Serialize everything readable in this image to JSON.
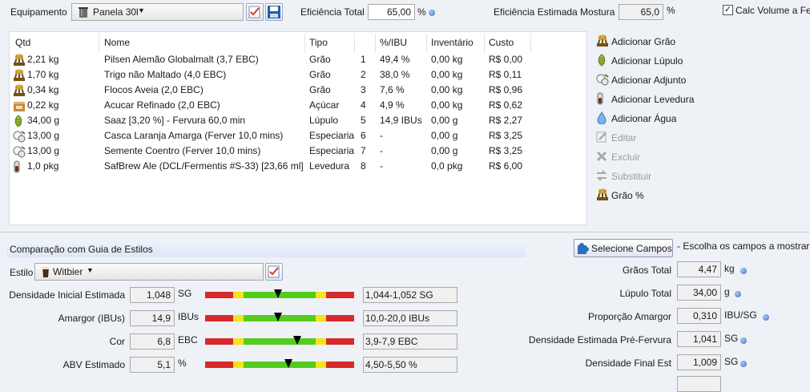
{
  "equipment": {
    "label": "Equipamento",
    "value": "Panela 30l",
    "total_efficiency_label": "Eficiência Total",
    "total_efficiency_value": "65,00",
    "total_efficiency_unit": "%",
    "mash_efficiency_label": "Eficiência Estimada Mostura",
    "mash_efficiency_value": "65,0",
    "mash_efficiency_unit": "%",
    "calc_volume_label": "Calc Volume a Fer",
    "calc_volume_checked": true
  },
  "ingredients": {
    "columns": [
      "Qtd",
      "Nome",
      "Tipo",
      "%/IBU",
      "Inventário",
      "Custo"
    ],
    "rows": [
      {
        "icon": "grain-icon",
        "qty": "2,21 kg",
        "name": "Pilsen Alemão Globalmalt (3,7 EBC)",
        "type": "Grão",
        "order": "1",
        "pct": "49,4 %",
        "inventory": "0,00 kg",
        "cost": "R$ 0,00"
      },
      {
        "icon": "grain-icon",
        "qty": "1,70 kg",
        "name": "Trigo não Maltado (4,0 EBC)",
        "type": "Grão",
        "order": "2",
        "pct": "38,0 %",
        "inventory": "0,00 kg",
        "cost": "R$ 0,11"
      },
      {
        "icon": "grain-icon",
        "qty": "0,34 kg",
        "name": "Flocos Aveia (2,0 EBC)",
        "type": "Grão",
        "order": "3",
        "pct": "7,6 %",
        "inventory": "0,00 kg",
        "cost": "R$ 0,96"
      },
      {
        "icon": "sugar-icon",
        "qty": "0,22 kg",
        "name": "Acucar Refinado (2,0 EBC)",
        "type": "Açúcar",
        "order": "4",
        "pct": "4,9 %",
        "inventory": "0,00 kg",
        "cost": "R$ 0,62"
      },
      {
        "icon": "hop-icon",
        "qty": "34,00 g",
        "name": "Saaz [3,20 %] - Fervura 60,0 min",
        "type": "Lúpulo",
        "order": "5",
        "pct": "14,9 IBUs",
        "inventory": "0,00 g",
        "cost": "R$ 2,27"
      },
      {
        "icon": "adjunct-icon",
        "qty": "13,00 g",
        "name": "Casca Laranja Amarga (Ferver 10,0 mins)",
        "type": "Especiaria",
        "order": "6",
        "pct": "-",
        "inventory": "0,00 g",
        "cost": "R$ 3,25"
      },
      {
        "icon": "adjunct-icon",
        "qty": "13,00 g",
        "name": "Semente Coentro (Ferver 10,0 mins)",
        "type": "Especiaria",
        "order": "7",
        "pct": "-",
        "inventory": "0,00 g",
        "cost": "R$ 3,25"
      },
      {
        "icon": "yeast-icon",
        "qty": "1,0 pkg",
        "name": "SafBrew Ale (DCL/Fermentis #S-33) [23,66 ml]",
        "type": "Levedura",
        "order": "8",
        "pct": "-",
        "inventory": "0,0 pkg",
        "cost": "R$ 6,00"
      }
    ]
  },
  "actions": [
    {
      "label": "Adicionar Grão",
      "icon": "grain-icon",
      "enabled": true
    },
    {
      "label": "Adicionar Lúpulo",
      "icon": "hop-icon",
      "enabled": true
    },
    {
      "label": "Adicionar Adjunto",
      "icon": "adjunct-icon",
      "enabled": true
    },
    {
      "label": "Adicionar Levedura",
      "icon": "yeast-icon",
      "enabled": true
    },
    {
      "label": "Adicionar Água",
      "icon": "water-drop-icon",
      "enabled": true
    },
    {
      "label": "Editar",
      "icon": "edit-icon",
      "enabled": false
    },
    {
      "label": "Excluir",
      "icon": "delete-icon",
      "enabled": false
    },
    {
      "label": "Substituir",
      "icon": "replace-icon",
      "enabled": false
    },
    {
      "label": "Grão %",
      "icon": "grain-icon",
      "enabled": true
    }
  ],
  "style_guide": {
    "section_title": "Comparação com Guia de Estilos",
    "style_label": "Estilo",
    "style_value": "Witbier",
    "rows": [
      {
        "label": "Densidade Inicial Estimada",
        "value": "1,048",
        "unit": "SG",
        "range": "1,044-1,052 SG",
        "position": 0.49
      },
      {
        "label": "Amargor (IBUs)",
        "value": "14,9",
        "unit": "IBUs",
        "range": "10,0-20,0 IBUs",
        "position": 0.49
      },
      {
        "label": "Cor",
        "value": "6,8",
        "unit": "EBC",
        "range": "3,9-7,9 EBC",
        "position": 0.62
      },
      {
        "label": "ABV Estimado",
        "value": "5,1",
        "unit": "%",
        "range": "4,50-5,50 %",
        "position": 0.56
      }
    ],
    "gauge_colors": {
      "red": "#d62a2a",
      "yellow": "#f2e51c",
      "green": "#53cc1f"
    }
  },
  "stats": {
    "select_fields_button": "Selecione Campos",
    "select_fields_hint": "- Escolha os campos a mostrar",
    "rows": [
      {
        "label": "Grãos Total",
        "value": "4,47",
        "unit": "kg"
      },
      {
        "label": "Lúpulo Total",
        "value": "34,00",
        "unit": "g"
      },
      {
        "label": "Proporção Amargor",
        "value": "0,310",
        "unit": "IBU/SG"
      },
      {
        "label": "Densidade Estimada Pré-Fervura",
        "value": "1,041",
        "unit": "SG"
      },
      {
        "label": "Densidade Final Est",
        "value": "1,009",
        "unit": "SG"
      }
    ]
  }
}
